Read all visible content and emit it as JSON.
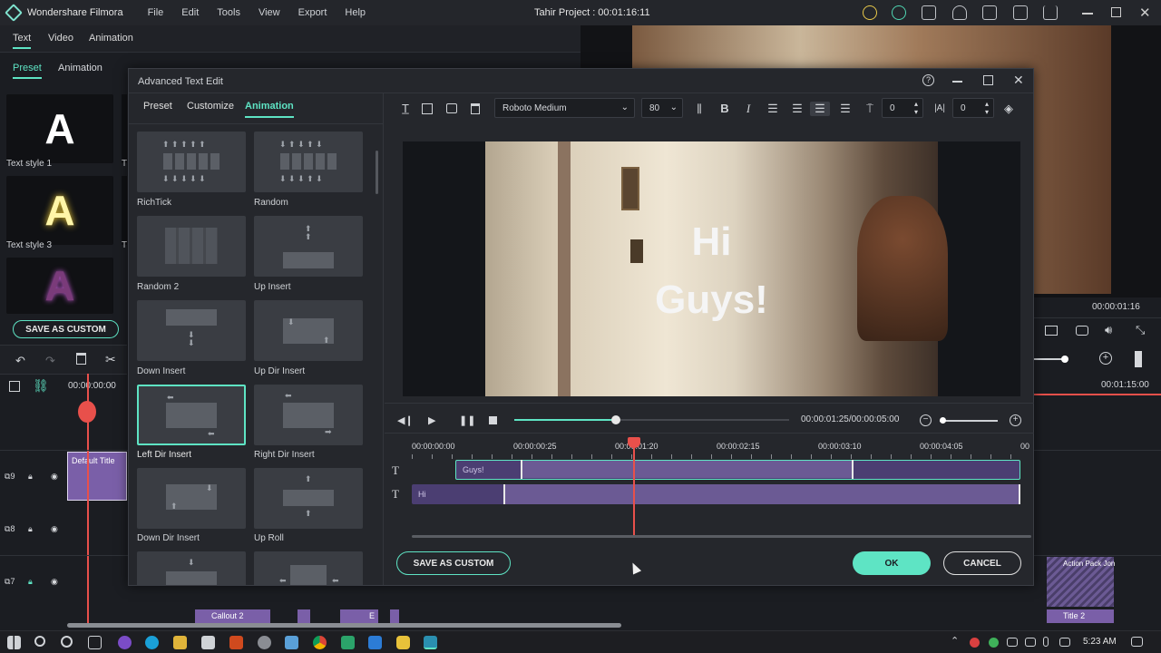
{
  "app": {
    "name": "Wondershare Filmora",
    "project_title": "Tahir Project : 00:01:16:11"
  },
  "menu": [
    "File",
    "Edit",
    "Tools",
    "View",
    "Export",
    "Help"
  ],
  "left_panel": {
    "tabs": [
      "Text",
      "Video",
      "Animation"
    ],
    "subtabs": [
      "Preset",
      "Animation"
    ],
    "styles": [
      {
        "label": "Text style 1",
        "glyph": "A"
      },
      {
        "label": "Text style 3",
        "glyph": "A"
      },
      {
        "label": "",
        "glyph": "A"
      }
    ],
    "partial_label": "T",
    "save_custom": "SAVE AS CUSTOM"
  },
  "left_timeline": {
    "time": "00:00:00:00",
    "tracks": [
      {
        "num": "9"
      },
      {
        "num": "8"
      },
      {
        "num": "7"
      }
    ],
    "clip_default_title": "Default Title",
    "bottom_clips": [
      "Callout 2",
      "E"
    ]
  },
  "dialog": {
    "title": "Advanced Text Edit",
    "tabs": [
      "Preset",
      "Customize",
      "Animation"
    ],
    "active_tab": "Animation",
    "font": "Roboto Medium",
    "font_size": "80",
    "char_spacing": "0",
    "line_spacing": "0",
    "animations": [
      {
        "label": "RichTick"
      },
      {
        "label": "Random"
      },
      {
        "label": "Random 2"
      },
      {
        "label": "Up Insert"
      },
      {
        "label": "Down Insert"
      },
      {
        "label": "Up Dir Insert"
      },
      {
        "label": "Left Dir Insert",
        "selected": true
      },
      {
        "label": "Right Dir Insert"
      },
      {
        "label": "Down Dir Insert"
      },
      {
        "label": "Up Roll"
      }
    ],
    "preview_text": {
      "line1": "Hi",
      "line2": "Guys!"
    },
    "playback": {
      "time": "00:00:01:25/00:00:05:00",
      "progress": 0.37
    },
    "ruler": [
      "00:00:00:00",
      "00:00:00:25",
      "00:00:01:20",
      "00:00:02:15",
      "00:00:03:10",
      "00:00:04:05",
      "00"
    ],
    "tracks": [
      {
        "label": "Guys!"
      },
      {
        "label": "Hi"
      }
    ],
    "track_icon": "T",
    "save_custom": "SAVE AS CUSTOM",
    "ok": "OK",
    "cancel": "CANCEL"
  },
  "right_panel": {
    "time": "00:00:01:16",
    "ruler_time": "00:01:15:00",
    "clips": [
      "Action Pack Jon",
      "Title 2"
    ]
  },
  "taskbar": {
    "clock": "5:23 AM"
  },
  "colors": {
    "accent": "#5ee4c4",
    "clip_purple": "#7a5fa8",
    "track_purple": "#6b5a94",
    "playhead": "#e8504b"
  }
}
